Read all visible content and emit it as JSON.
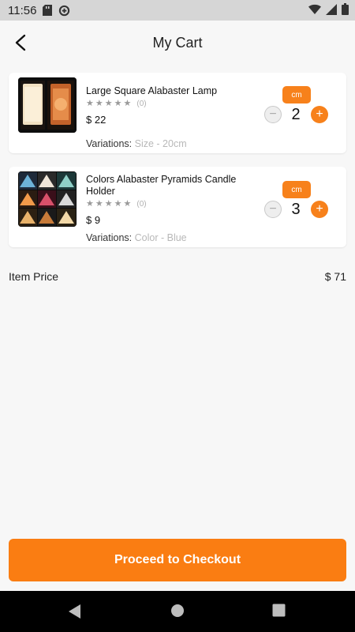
{
  "status_bar": {
    "time": "11:56",
    "left_icons": [
      "sd-card-icon",
      "data-saver-icon"
    ],
    "right_icons": [
      "wifi-icon",
      "cell-signal-icon",
      "battery-icon"
    ]
  },
  "header": {
    "title": "My Cart",
    "back_icon": "arrow-back-icon"
  },
  "cart": {
    "items": [
      {
        "name": "Large Square Alabaster Lamp",
        "rating_count": "(0)",
        "stars": 5,
        "price": "$ 22",
        "unit": "cm",
        "quantity": "2",
        "variation_label": "Variations:",
        "variation_value": "Size - 20cm"
      },
      {
        "name": "Colors Alabaster Pyramids Candle Holder",
        "rating_count": "(0)",
        "stars": 5,
        "price": "$ 9",
        "unit": "cm",
        "quantity": "3",
        "variation_label": "Variations:",
        "variation_value": "Color - Blue"
      }
    ]
  },
  "summary": {
    "item_price_label": "Item Price",
    "item_price_value": "$ 71"
  },
  "checkout_button": {
    "label": "Proceed to Checkout"
  },
  "colors": {
    "accent": "#f7811b",
    "status_bar": "#d6d6d6",
    "nav_bar": "#000000",
    "background": "#f7f7f7"
  }
}
